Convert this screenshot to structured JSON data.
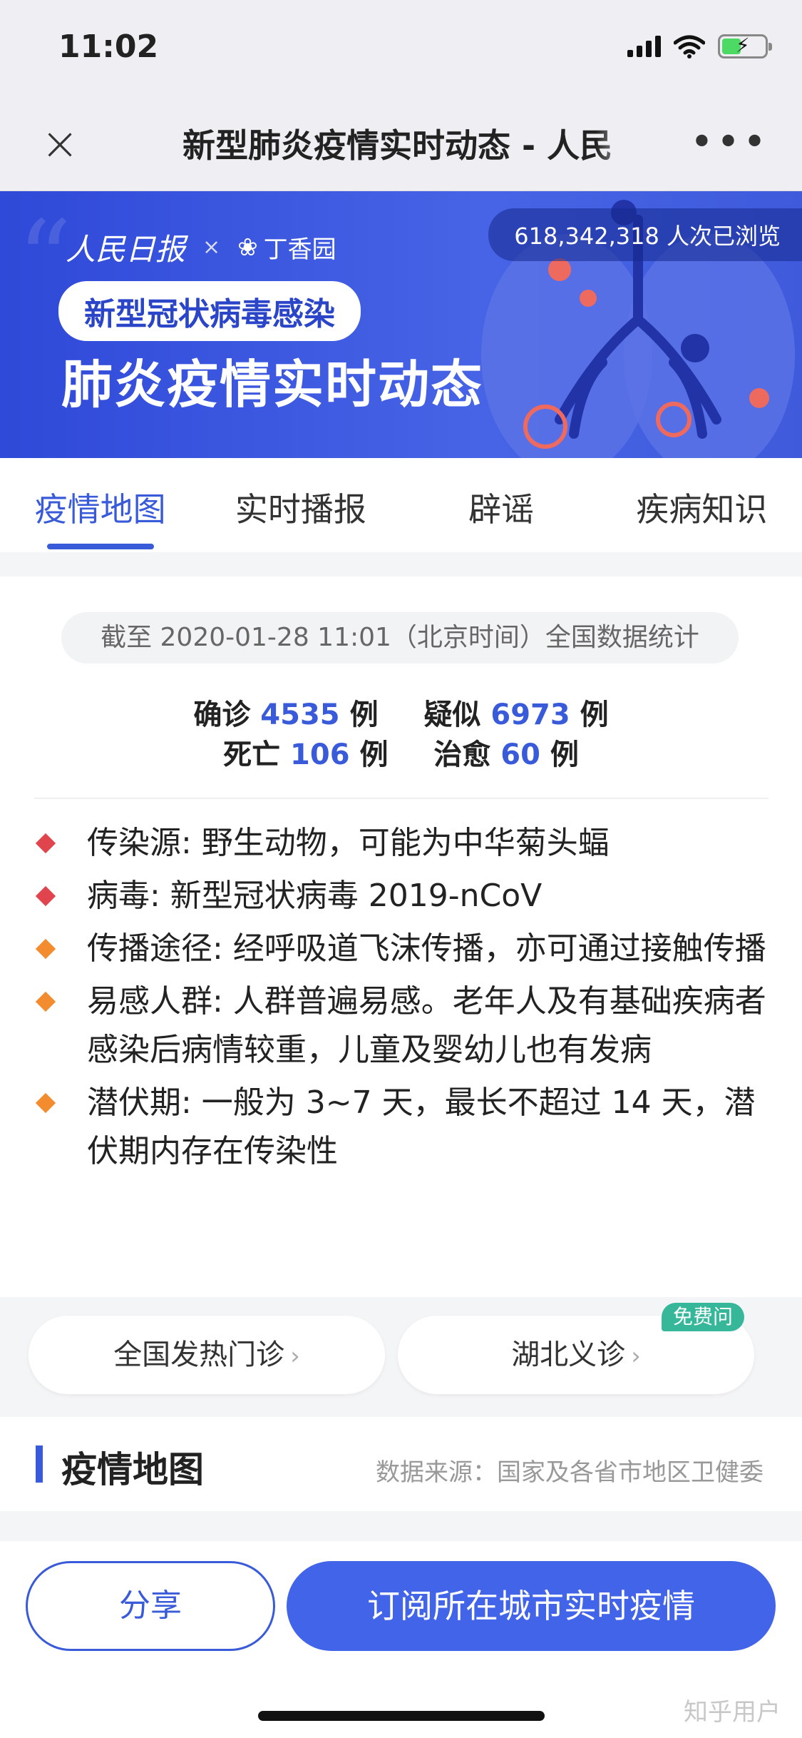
{
  "status_bar": {
    "time": "11:02"
  },
  "nav": {
    "close_icon": "close-icon",
    "title": "新型肺炎疫情实时动态 - 人民",
    "more_icon": "more-icon"
  },
  "banner": {
    "brand_left": "人民日报",
    "brand_x": "×",
    "brand_right": "丁香园",
    "pill": "新型冠状病毒感染",
    "headline": "肺炎疫情实时动态",
    "views": "618,342,318 人次已浏览"
  },
  "tabs": [
    {
      "label": "疫情地图",
      "active": true
    },
    {
      "label": "实时播报",
      "active": false
    },
    {
      "label": "辟谣",
      "active": false
    },
    {
      "label": "疾病知识",
      "active": false
    }
  ],
  "stats": {
    "as_of": "截至 2020-01-28 11:01（北京时间）全国数据统计",
    "confirmed_label": "确诊",
    "confirmed": "4535",
    "confirmed_unit": "例",
    "suspected_label": "疑似",
    "suspected": "6973",
    "suspected_unit": "例",
    "dead_label": "死亡",
    "dead": "106",
    "dead_unit": "例",
    "cured_label": "治愈",
    "cured": "60",
    "cured_unit": "例"
  },
  "facts": [
    {
      "text": "传染源: 野生动物，可能为中华菊头蝠",
      "color": "red"
    },
    {
      "text": "病毒: 新型冠状病毒 2019-nCoV",
      "color": "red"
    },
    {
      "text": "传播途径: 经呼吸道飞沫传播，亦可通过接触传播",
      "color": "orange"
    },
    {
      "text": "易感人群: 人群普遍易感。老年人及有基础疾病者感染后病情较重，儿童及婴幼儿也有发病",
      "color": "orange"
    },
    {
      "text": "潜伏期: 一般为 3~7 天，最长不超过 14 天，潜伏期内存在传染性",
      "color": "orange"
    }
  ],
  "quick": {
    "fever_clinic": "全国发热门诊",
    "hubei_clinic": "湖北义诊",
    "free_badge": "免费问"
  },
  "section": {
    "title": "疫情地图",
    "source": "数据来源：国家及各省市地区卫健委"
  },
  "bottom": {
    "share": "分享",
    "subscribe": "订阅所在城市实时疫情",
    "watermark": "知乎用户"
  },
  "colors": {
    "accent": "#3a5bd9",
    "banner": "#3f5bdc",
    "red": "#e0454d",
    "orange": "#f28c2e",
    "badge": "#37b79a"
  }
}
